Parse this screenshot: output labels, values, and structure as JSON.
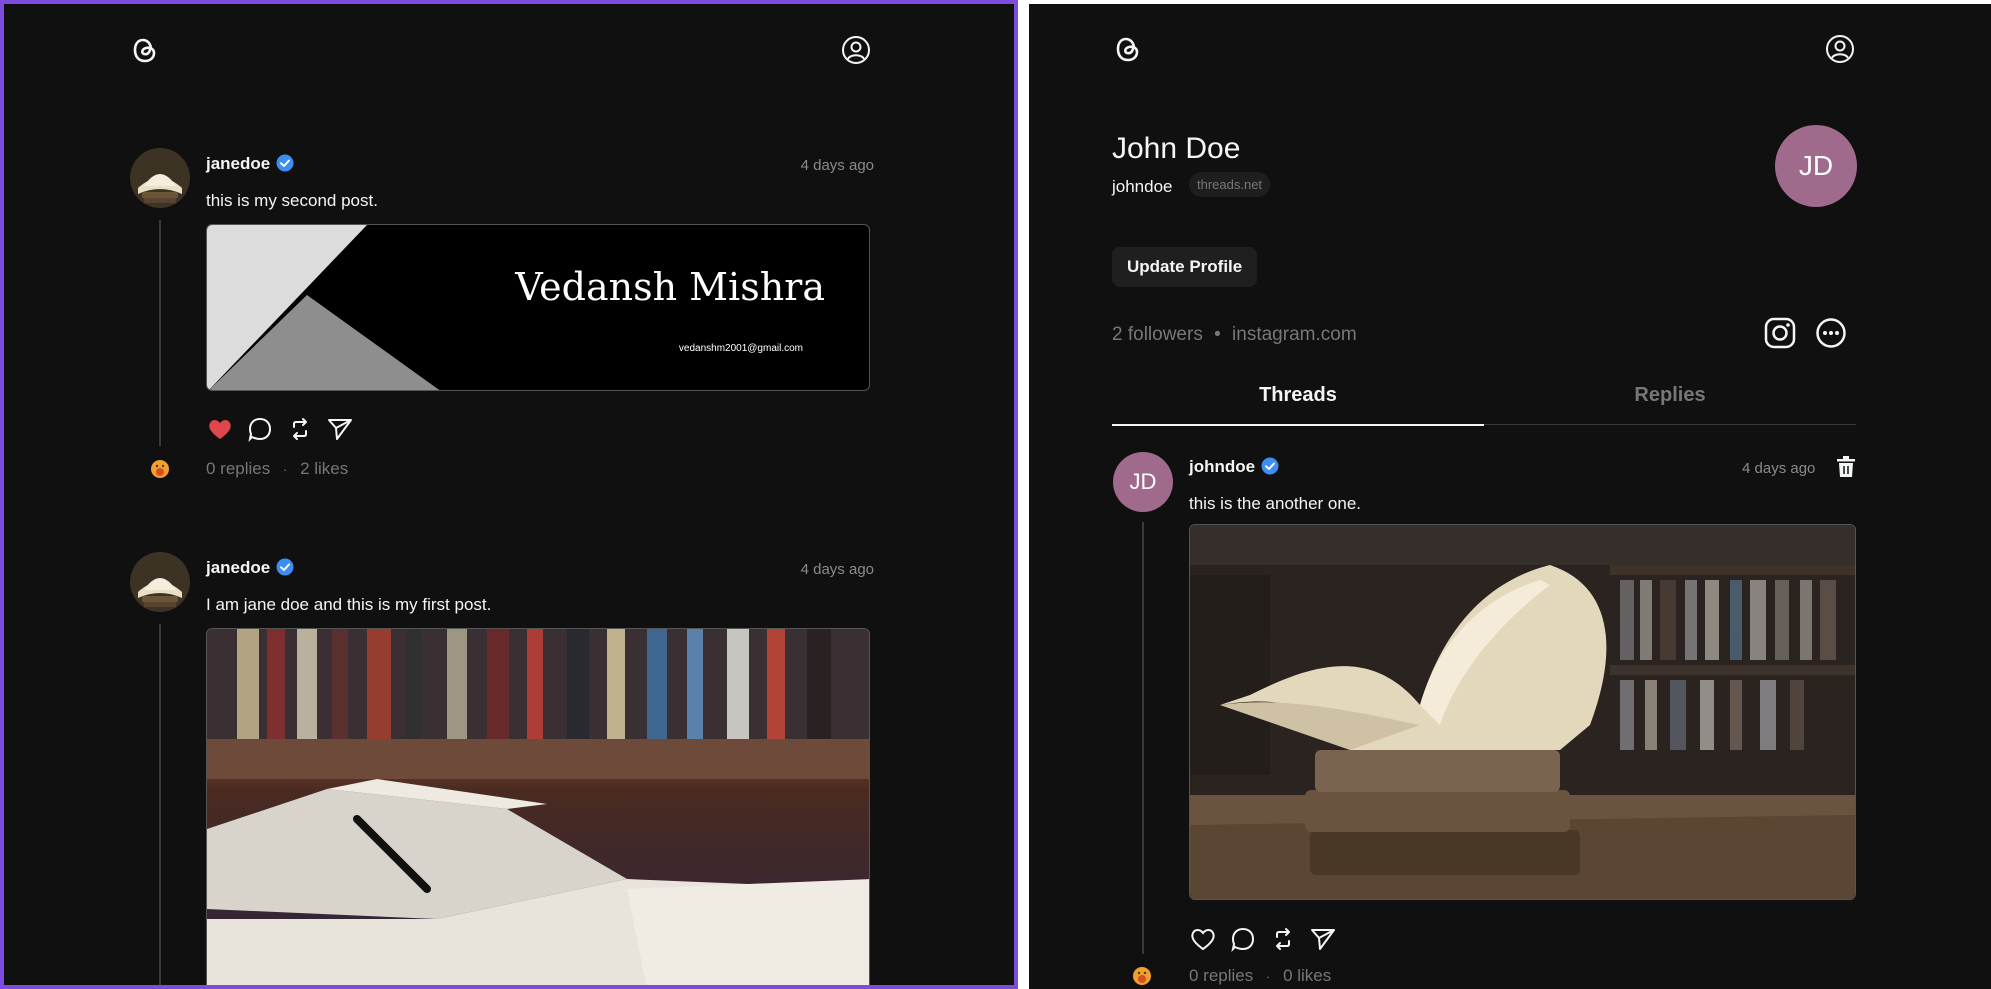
{
  "left": {
    "posts": [
      {
        "username": "janedoe",
        "time": "4 days ago",
        "text": "this is my second post.",
        "banner_name": "Vedansh Mishra",
        "banner_email": "vedanshm2001@gmail.com",
        "replies": "0 replies",
        "likes": "2 likes",
        "liked": true
      },
      {
        "username": "janedoe",
        "time": "4 days ago",
        "text": "I am jane doe and this is my first post."
      }
    ],
    "separator": "·"
  },
  "right": {
    "name": "John Doe",
    "handle": "johndoe",
    "domain_badge": "threads.net",
    "avatar_initials": "JD",
    "update_button": "Update Profile",
    "followers": "2 followers",
    "dot": "•",
    "link": "instagram.com",
    "tabs": [
      {
        "label": "Threads",
        "active": true
      },
      {
        "label": "Replies",
        "active": false
      }
    ],
    "post": {
      "avatar_initials": "JD",
      "username": "johndoe",
      "time": "4 days ago",
      "text": "this is the another one.",
      "replies": "0 replies",
      "likes": "0 likes"
    },
    "separator": "·"
  },
  "colors": {
    "background": "#101010",
    "accent_border": "#7c4ddc",
    "avatar_bg": "#a06a8c",
    "like_red": "#e0474c",
    "verified_blue": "#3d8ef2"
  }
}
